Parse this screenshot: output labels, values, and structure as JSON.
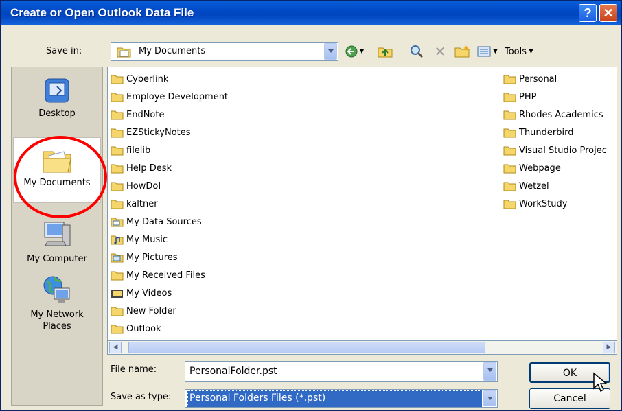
{
  "window": {
    "title": "Create or Open Outlook Data File"
  },
  "save_in": {
    "label": "Save in:",
    "value": "My Documents"
  },
  "toolbar": {
    "tools_label": "Tools"
  },
  "places": [
    {
      "name": "Desktop",
      "icon": "desktop-icon"
    },
    {
      "name": "My Documents",
      "icon": "my-documents-icon"
    },
    {
      "name": "My Computer",
      "icon": "my-computer-icon"
    },
    {
      "name": "My Network Places",
      "icon": "my-network-places-icon"
    }
  ],
  "files": {
    "left_column": [
      {
        "name": "Cyberlink",
        "icon": "folder-icon"
      },
      {
        "name": "Employe Development",
        "icon": "folder-icon"
      },
      {
        "name": "EndNote",
        "icon": "folder-icon"
      },
      {
        "name": "EZStickyNotes",
        "icon": "folder-icon"
      },
      {
        "name": "filelib",
        "icon": "folder-icon"
      },
      {
        "name": "Help Desk",
        "icon": "folder-icon"
      },
      {
        "name": "HowDoI",
        "icon": "folder-icon"
      },
      {
        "name": "kaltner",
        "icon": "folder-icon"
      },
      {
        "name": "My Data Sources",
        "icon": "data-sources-folder-icon"
      },
      {
        "name": "My Music",
        "icon": "music-folder-icon"
      },
      {
        "name": "My Pictures",
        "icon": "pictures-folder-icon"
      },
      {
        "name": "My Received Files",
        "icon": "folder-icon"
      },
      {
        "name": "My Videos",
        "icon": "videos-folder-icon"
      },
      {
        "name": "New Folder",
        "icon": "folder-icon"
      },
      {
        "name": "Outlook",
        "icon": "folder-icon"
      }
    ],
    "right_column": [
      {
        "name": "Personal",
        "icon": "folder-icon"
      },
      {
        "name": "PHP",
        "icon": "folder-icon"
      },
      {
        "name": "Rhodes Academics",
        "icon": "folder-icon"
      },
      {
        "name": "Thunderbird",
        "icon": "folder-icon"
      },
      {
        "name": "Visual Studio Projec",
        "icon": "folder-icon"
      },
      {
        "name": "Webpage",
        "icon": "folder-icon"
      },
      {
        "name": "Wetzel",
        "icon": "folder-icon"
      },
      {
        "name": "WorkStudy",
        "icon": "folder-icon"
      }
    ]
  },
  "file_name": {
    "label": "File name:",
    "value": "PersonalFolder.pst"
  },
  "save_as_type": {
    "label": "Save as type:",
    "value": "Personal Folders Files (*.pst)"
  },
  "buttons": {
    "ok": "OK",
    "cancel": "Cancel"
  },
  "colors": {
    "titlebar": "#0054e3",
    "selection": "#316ac5",
    "folder": "#f5d66b",
    "annotation": "#ff0000"
  }
}
